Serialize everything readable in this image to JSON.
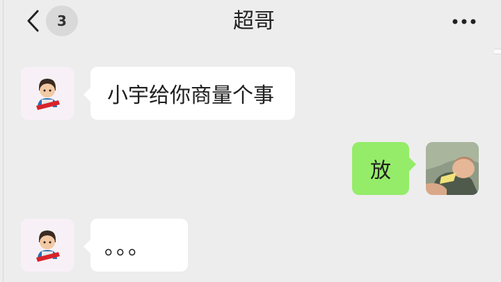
{
  "header": {
    "back_icon": "chevron-left-icon",
    "unread_count": "3",
    "title": "超哥",
    "more_icon": "more-dots-icon"
  },
  "messages": [
    {
      "side": "left",
      "sender_avatar": "boy-avatar",
      "text": "小宇给你商量个事"
    },
    {
      "side": "right",
      "sender_avatar": "photo-avatar",
      "text": "放"
    },
    {
      "side": "left",
      "sender_avatar": "boy-avatar",
      "text": "。。。"
    }
  ],
  "colors": {
    "background": "#ededed",
    "incoming_bubble": "#ffffff",
    "outgoing_bubble": "#95ec69"
  }
}
